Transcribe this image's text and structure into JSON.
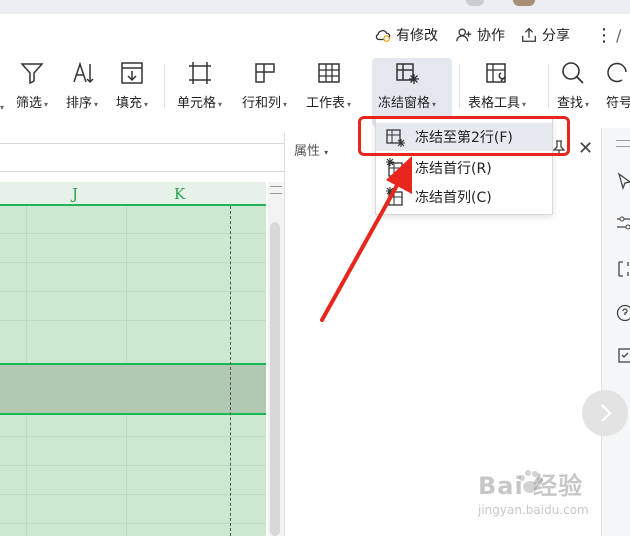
{
  "collab": {
    "modify_label": "有修改",
    "cooperate_label": "协作",
    "share_label": "分享"
  },
  "ribbon": {
    "items": [
      {
        "label": "筛选"
      },
      {
        "label": "排序"
      },
      {
        "label": "填充"
      },
      {
        "label": "单元格"
      },
      {
        "label": "行和列"
      },
      {
        "label": "工作表"
      },
      {
        "label": "冻结窗格"
      },
      {
        "label": "表格工具"
      },
      {
        "label": "查找"
      },
      {
        "label": "符号"
      }
    ]
  },
  "sheet": {
    "columns": [
      "J",
      "K"
    ]
  },
  "properties": {
    "label": "属性"
  },
  "freeze_menu": {
    "items": [
      {
        "label": "冻结至第2行(F)"
      },
      {
        "label": "冻结首行(R)"
      },
      {
        "label": "冻结首列(C)"
      }
    ]
  },
  "watermark": {
    "brand": "Bai  经验",
    "url": "jingyan.baidu.com"
  },
  "colors": {
    "accent_red": "#e8261d",
    "sheet_green": "#cde8d1",
    "freeze_line": "#16b956"
  }
}
